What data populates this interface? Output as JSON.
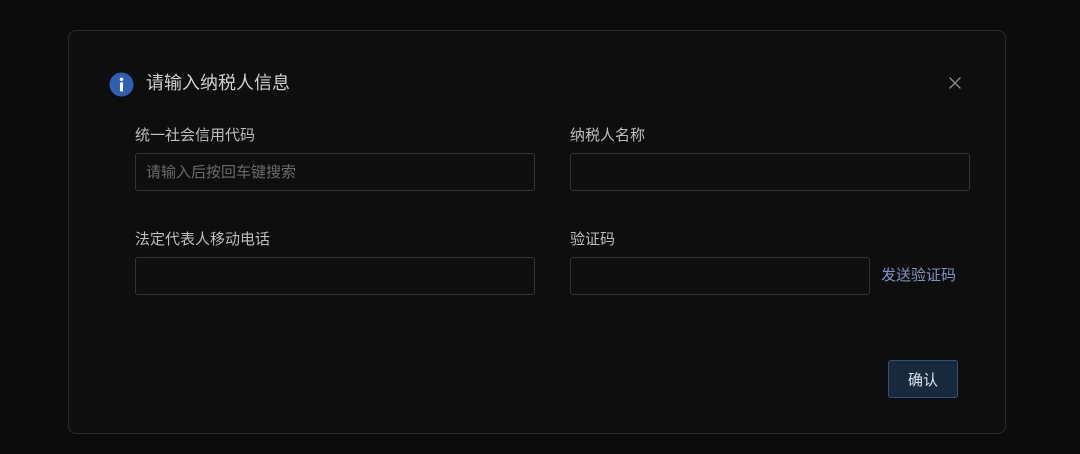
{
  "dialog": {
    "title": "请输入纳税人信息",
    "icon": "info-circle-icon",
    "accent_color": "#2f5fb3"
  },
  "fields": {
    "credit_code": {
      "label": "统一社会信用代码",
      "placeholder": "请输入后按回车键搜索",
      "value": ""
    },
    "taxpayer_name": {
      "label": "纳税人名称",
      "placeholder": "",
      "value": ""
    },
    "legal_phone": {
      "label": "法定代表人移动电话",
      "placeholder": "",
      "value": ""
    },
    "verify_code": {
      "label": "验证码",
      "placeholder": "",
      "value": ""
    }
  },
  "send_code_label": "发送验证码",
  "confirm_label": "确认"
}
